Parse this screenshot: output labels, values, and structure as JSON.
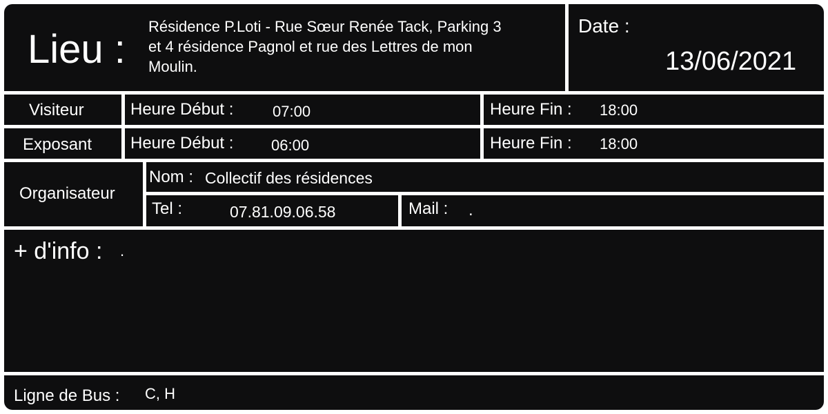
{
  "lieu": {
    "label": "Lieu :",
    "line1": "Résidence P.Loti - Rue Sœur Renée Tack, Parking 3",
    "line2": "et 4 résidence Pagnol et rue des Lettres de mon",
    "line3": "Moulin."
  },
  "date": {
    "label": "Date :",
    "value": "13/06/2021"
  },
  "visiteur": {
    "label": "Visiteur",
    "debut_label": "Heure Début :",
    "debut_value": "07:00",
    "fin_label": "Heure Fin :",
    "fin_value": "18:00"
  },
  "exposant": {
    "label": "Exposant",
    "debut_label": "Heure Début :",
    "debut_value": "06:00",
    "fin_label": "Heure Fin :",
    "fin_value": "18:00"
  },
  "organisateur": {
    "label": "Organisateur",
    "nom_label": "Nom :",
    "nom_value": "Collectif des résidences",
    "tel_label": "Tel :",
    "tel_value": "07.81.09.06.58",
    "mail_label": "Mail :",
    "mail_value": "."
  },
  "info": {
    "label": "+ d'info :",
    "value": "."
  },
  "bus": {
    "label": "Ligne de Bus :",
    "value": "C, H"
  },
  "colors": {
    "cell_bg": "#0e0e0f",
    "text": "#ffffff",
    "border": "#ffffff"
  }
}
